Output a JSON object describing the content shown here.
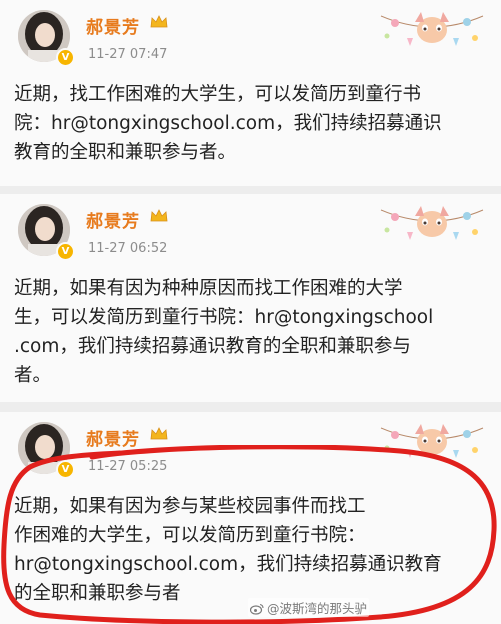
{
  "posts": [
    {
      "author": "郝景芳",
      "timestamp": "11-27 07:47",
      "lines": [
        "近期，找工作困难的大学生，可以发简历到童行书",
        "院：hr@tongxingschool.com，我们持续招募通识",
        "教育的全职和兼职参与者。"
      ]
    },
    {
      "author": "郝景芳",
      "timestamp": "11-27 06:52",
      "lines": [
        "近期，如果有因为种种原因而找工作困难的大学",
        "生，可以发简历到童行书院：hr@tongxingschool",
        ".com，我们持续招募通识教育的全职和兼职参与",
        "者。"
      ]
    },
    {
      "author": "郝景芳",
      "timestamp": "11-27 05:25",
      "lines": [
        "近期，如果有因为参与某些校园事件而找工",
        "作困难的大学生，可以发简历到童行书院：",
        "hr@tongxingschool.com，我们持续招募通识教育",
        "的全职和兼职参与者"
      ]
    }
  ],
  "watermark": {
    "text": "@波斯湾的那头驴",
    "icon": "weibo-icon"
  },
  "icons": {
    "verified": "verified-badge-icon",
    "crown": "crown-icon",
    "decoration": "card-decoration-icon"
  },
  "colors": {
    "author_name": "#e77b1e",
    "verified_badge": "#f7b500",
    "annotation_circle": "#e0201c",
    "timestamp": "#8c8c8c"
  }
}
